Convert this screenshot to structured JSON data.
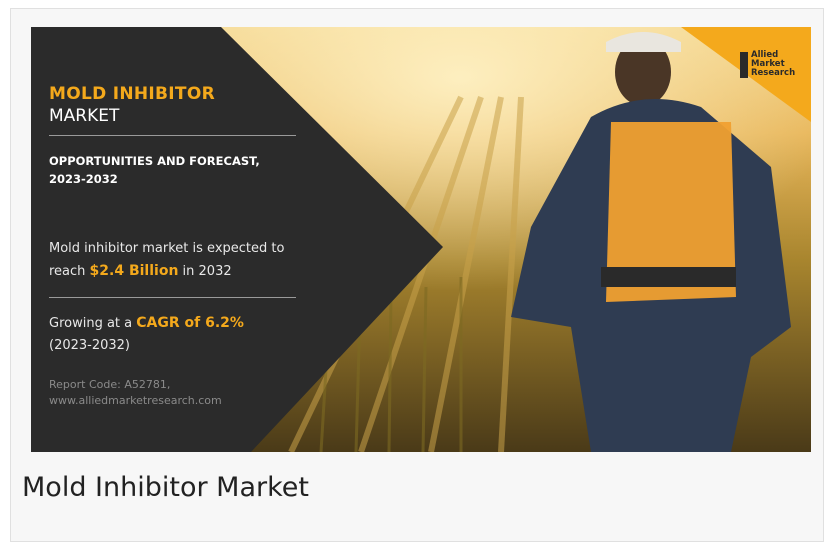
{
  "banner": {
    "title_highlight": "MOLD INHIBITOR",
    "title_rest": "MARKET",
    "subtitle_line1": "OPPORTUNITIES AND FORECAST,",
    "subtitle_line2": "2023-2032",
    "stat1_pre": "Mold inhibitor market is expected to reach ",
    "stat1_value": "$2.4 Billion",
    "stat1_post": " in 2032",
    "stat2_pre": "Growing at a ",
    "stat2_value": "CAGR of 6.2%",
    "stat2_post": "(2023-2032)",
    "report_code": "Report Code: A52781,",
    "website": "www.alliedmarketresearch.com"
  },
  "logo": {
    "line1": "Allied",
    "line2": "Market",
    "line3": "Research",
    "icon": "allied-market-research-logo-icon"
  },
  "caption": "Mold Inhibitor Market",
  "colors": {
    "accent": "#f4a91c",
    "panel": "#2b2b2b",
    "logo_bg": "#f4a91c"
  }
}
